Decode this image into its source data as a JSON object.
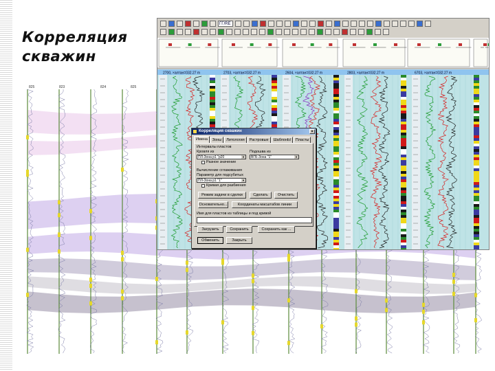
{
  "slide": {
    "title_line1": "Корреляция",
    "title_line2": "скважин"
  },
  "background_panel": {
    "well_labels": [
      "825",
      "823",
      "824",
      "825"
    ]
  },
  "window": {
    "toolbar_field": "ГГ/RE",
    "header_labels": [
      "2700, ×алтан=032.27 m",
      "2703, ×алтан=032.27 m",
      "2604, ×алтан=032.27 m",
      "2803, ×алтан=032.27 m",
      "6703, ×алтан=032.27 m"
    ]
  },
  "dialog": {
    "title": "Корреляция скважин",
    "close": "×",
    "tabs": [
      "Имена",
      "Зоны",
      "Литология",
      "Растровые",
      "ШаблонЫ",
      "Пласты"
    ],
    "section_top_label": "Интервалы пластов",
    "sublabel_left": "Кровля из",
    "sublabel_right": "Подошва из",
    "combo_left": "ПЛ-Зона р1 \"р20",
    "combo_right": "ВГБ-Зона \"1\"",
    "check_label": "Разное значение",
    "section_mid_label": "Вычисление сглаживания",
    "param_label": "Параметр для подсубитых",
    "combo_param": "ПЛ-Зона р1 \"1\"",
    "radio_label": "Кривая для разбиения",
    "btn_mode": "Режим задачи в сделки",
    "btn_ok_small": "Сделать",
    "btn_clear_small": "Очистить",
    "btn_interpret": "Основательно...",
    "btn_coords": "Координаты масштабов линии",
    "footer_label": "Имя для пластов из таблицы и под кривой",
    "btn_load": "Загрузить",
    "btn_save": "Сохранить",
    "btn_save_as": "Сохранить как ...",
    "btn_apply": "Обменить",
    "btn_close": "Закрыть"
  },
  "colors": {
    "bands": [
      "#f1dbf1",
      "#d7c8ee",
      "#c9c3d6",
      "#d9d7dd",
      "#bcb6c6"
    ],
    "window_track_bg": "#bfe3e6",
    "header_blue": "#8fc4ef",
    "dialog_title": "#0a246a"
  }
}
